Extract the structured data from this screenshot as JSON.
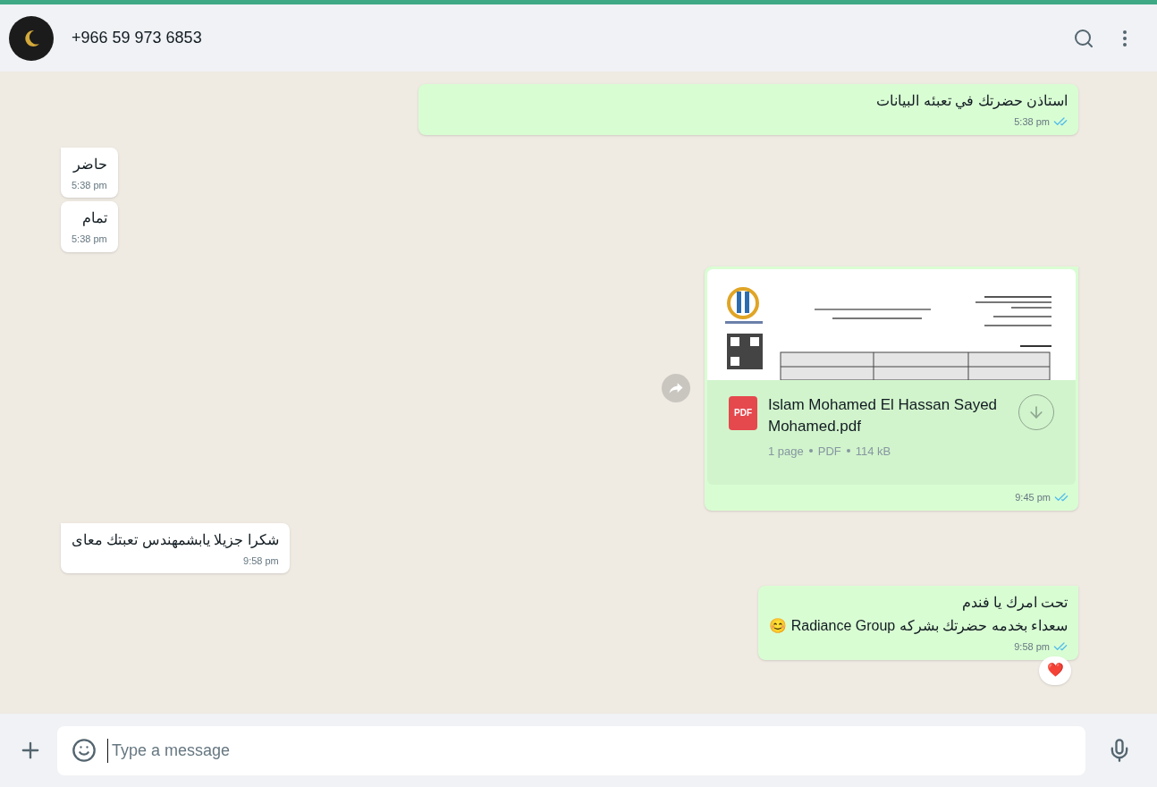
{
  "header": {
    "contact": "+966 59 973 6853"
  },
  "messages": [
    {
      "kind": "text",
      "outgoing": true,
      "text": "استاذن حضرتك في تعبئه البيانات",
      "time": "5:38 pm",
      "read": true,
      "tail": false
    },
    {
      "kind": "text",
      "outgoing": false,
      "text": "حاضر",
      "time": "5:38 pm",
      "tail": true
    },
    {
      "kind": "text",
      "outgoing": false,
      "text": "تمام",
      "time": "5:38 pm",
      "tail": false
    },
    {
      "kind": "document",
      "outgoing": true,
      "file_name": "Islam Mohamed El Hassan Sayed Mohamed.pdf",
      "file_type": "PDF",
      "meta": [
        "1 page",
        "PDF",
        "114 kB"
      ],
      "time": "9:45 pm",
      "read": true,
      "tail": true
    },
    {
      "kind": "text",
      "outgoing": false,
      "text": "شكرا جزيلا يابشمهندس تعبتك معاى",
      "time": "9:58 pm",
      "tail": true
    },
    {
      "kind": "text",
      "outgoing": true,
      "lines": [
        "تحت امرك يا فندم",
        "سعداء بخدمه حضرتك بشركه Radiance Group 😊"
      ],
      "time": "9:58 pm",
      "read": true,
      "tail": true,
      "reaction": "❤️"
    }
  ],
  "composer": {
    "placeholder": "Type a message"
  }
}
